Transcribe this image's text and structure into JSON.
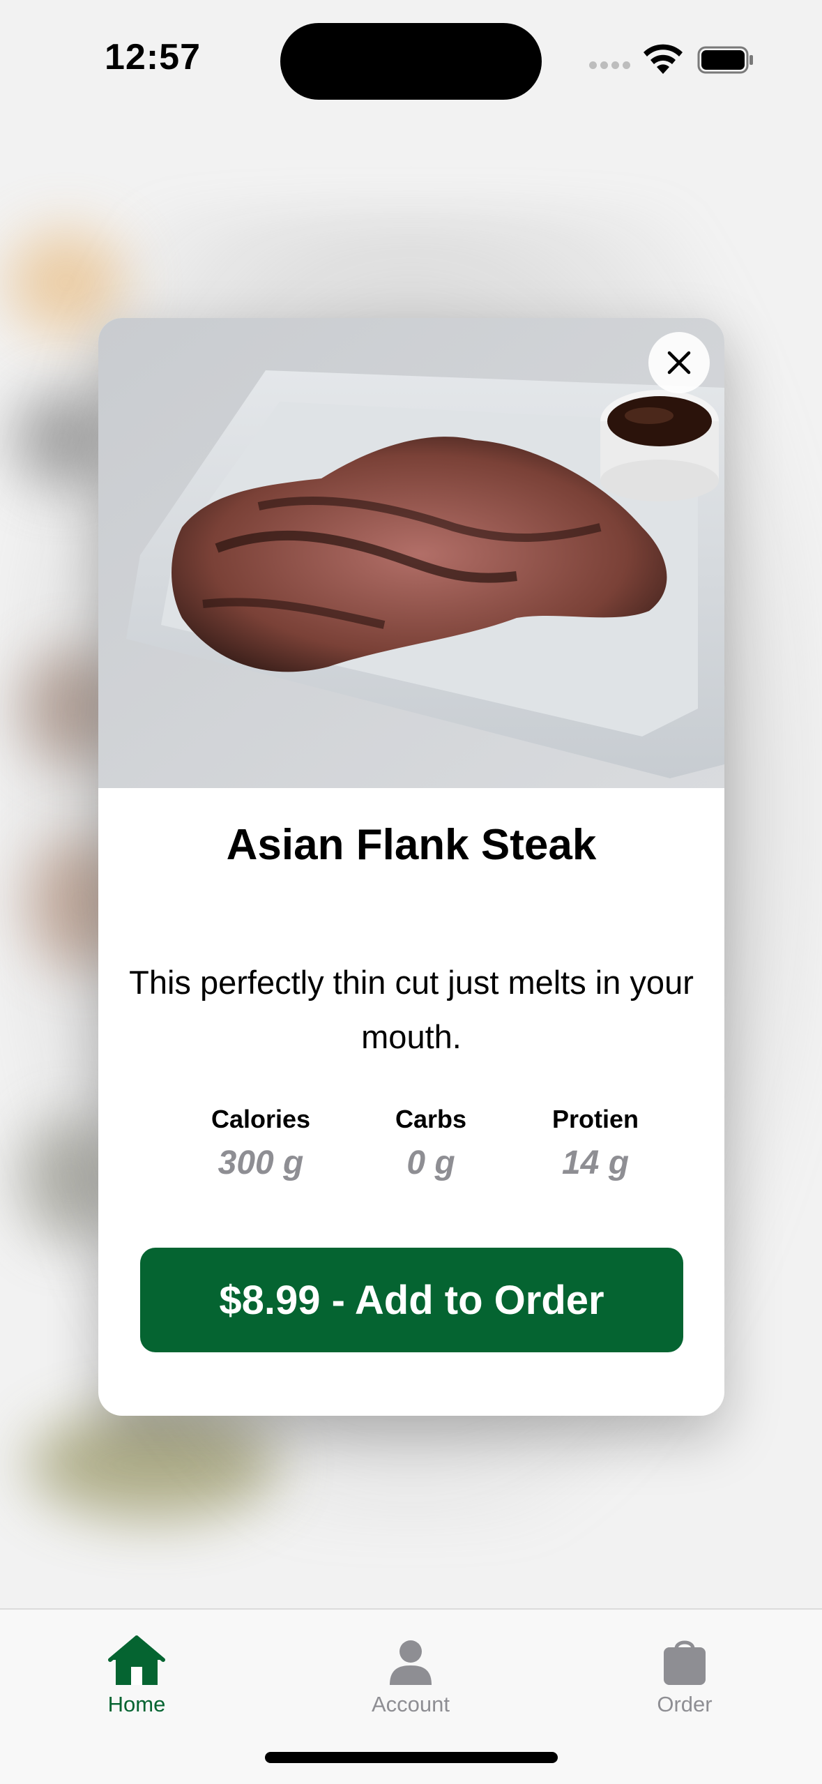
{
  "status_bar": {
    "time": "12:57"
  },
  "item": {
    "name": "Asian Flank Steak",
    "description": "This perfectly thin cut just melts in your mouth.",
    "nutrition": [
      {
        "label": "Calories",
        "value": "300 g"
      },
      {
        "label": "Carbs",
        "value": "0 g"
      },
      {
        "label": "Protien",
        "value": "14 g"
      }
    ],
    "add_button_label": "$8.99 - Add to Order"
  },
  "tab_bar": {
    "tabs": [
      {
        "label": "Home",
        "icon": "house-icon",
        "selected": true
      },
      {
        "label": "Account",
        "icon": "person-icon",
        "selected": false
      },
      {
        "label": "Order",
        "icon": "bag-icon",
        "selected": false
      }
    ]
  },
  "colors": {
    "accent": "#056431",
    "inactive_gray": "#8e8e93"
  }
}
